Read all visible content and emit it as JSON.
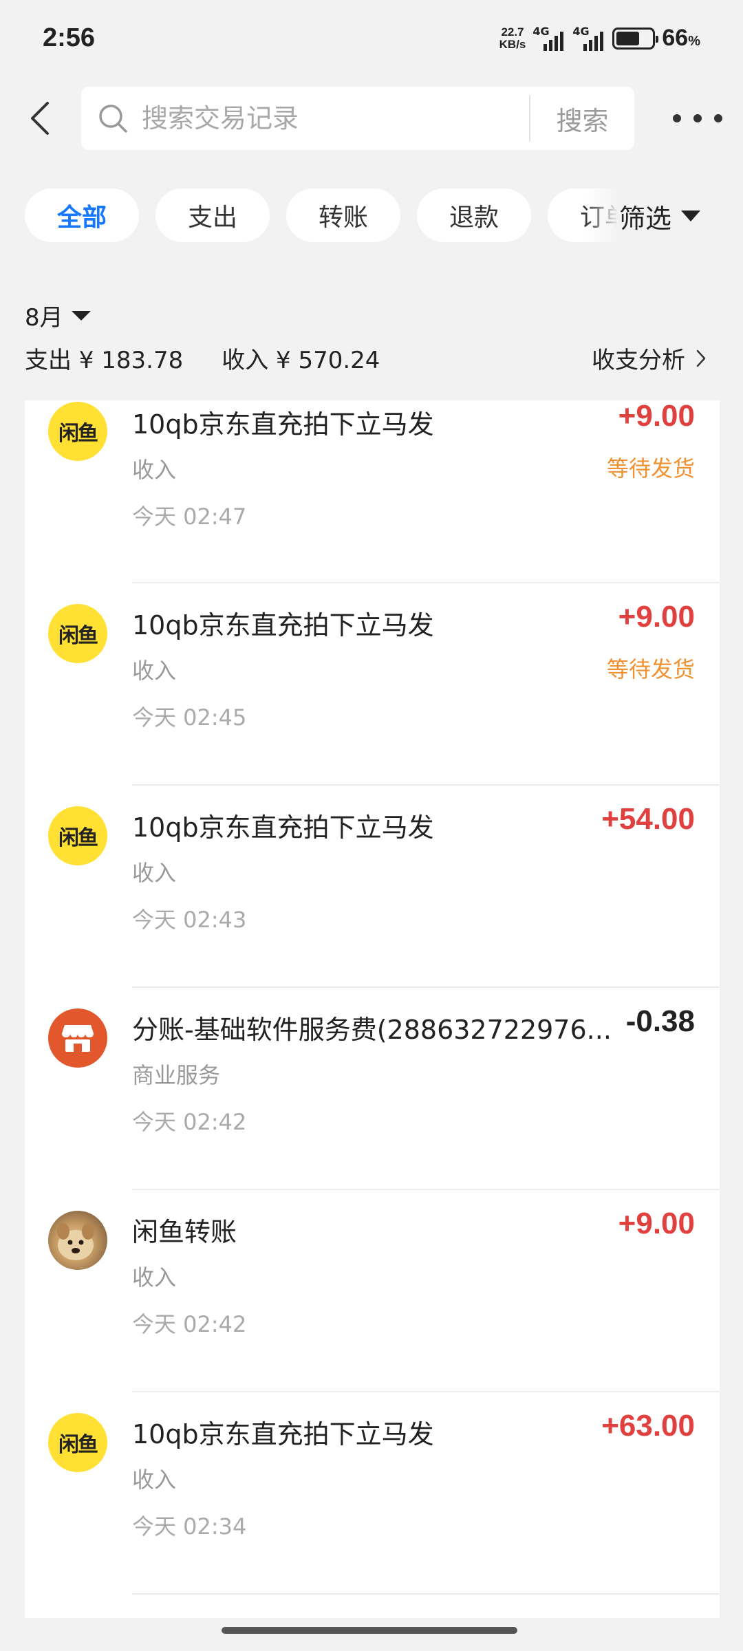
{
  "status_bar": {
    "time": "2:56",
    "net_speed_value": "22.7",
    "net_speed_unit": "KB/s",
    "signal1_label": "4G",
    "signal2_label": "4G",
    "battery_level": 0.66,
    "battery_percent": "66",
    "battery_unit": "%"
  },
  "search": {
    "placeholder": "搜索交易记录",
    "button_label": "搜索"
  },
  "filter": {
    "chips": [
      "全部",
      "支出",
      "转账",
      "退款",
      "订单"
    ],
    "active_index": 0,
    "filter_label": "筛选"
  },
  "summary": {
    "month": "8月",
    "expense": "支出 ¥ 183.78",
    "income": "收入 ¥ 570.24",
    "analysis_label": "收支分析"
  },
  "transactions": [
    {
      "avatar": "xianyu-logo",
      "title": "10qb京东直充拍下立马发",
      "category": "收入",
      "time": "今天 02:47",
      "amount": "+9.00",
      "status": "等待发货"
    },
    {
      "avatar": "xianyu-logo",
      "title": "10qb京东直充拍下立马发",
      "category": "收入",
      "time": "今天 02:45",
      "amount": "+9.00",
      "status": "等待发货"
    },
    {
      "avatar": "xianyu-logo",
      "title": "10qb京东直充拍下立马发",
      "category": "收入",
      "time": "今天 02:43",
      "amount": "+54.00",
      "status": ""
    },
    {
      "avatar": "shop-icon",
      "title": "分账-基础软件服务费(288632722976...",
      "category": "商业服务",
      "time": "今天 02:42",
      "amount": "-0.38",
      "status": ""
    },
    {
      "avatar": "dog-photo",
      "title": "闲鱼转账",
      "category": "收入",
      "time": "今天 02:42",
      "amount": "+9.00",
      "status": ""
    },
    {
      "avatar": "xianyu-logo",
      "title": "10qb京东直充拍下立马发",
      "category": "收入",
      "time": "今天 02:34",
      "amount": "+63.00",
      "status": ""
    }
  ],
  "xianyu_logo_text": "闲鱼",
  "colors": {
    "accent": "#1677ff",
    "income": "#e0413f",
    "expense": "#222222",
    "pending": "#f09232",
    "xianyu_yellow": "#ffe033",
    "shop_orange": "#e2582c"
  }
}
